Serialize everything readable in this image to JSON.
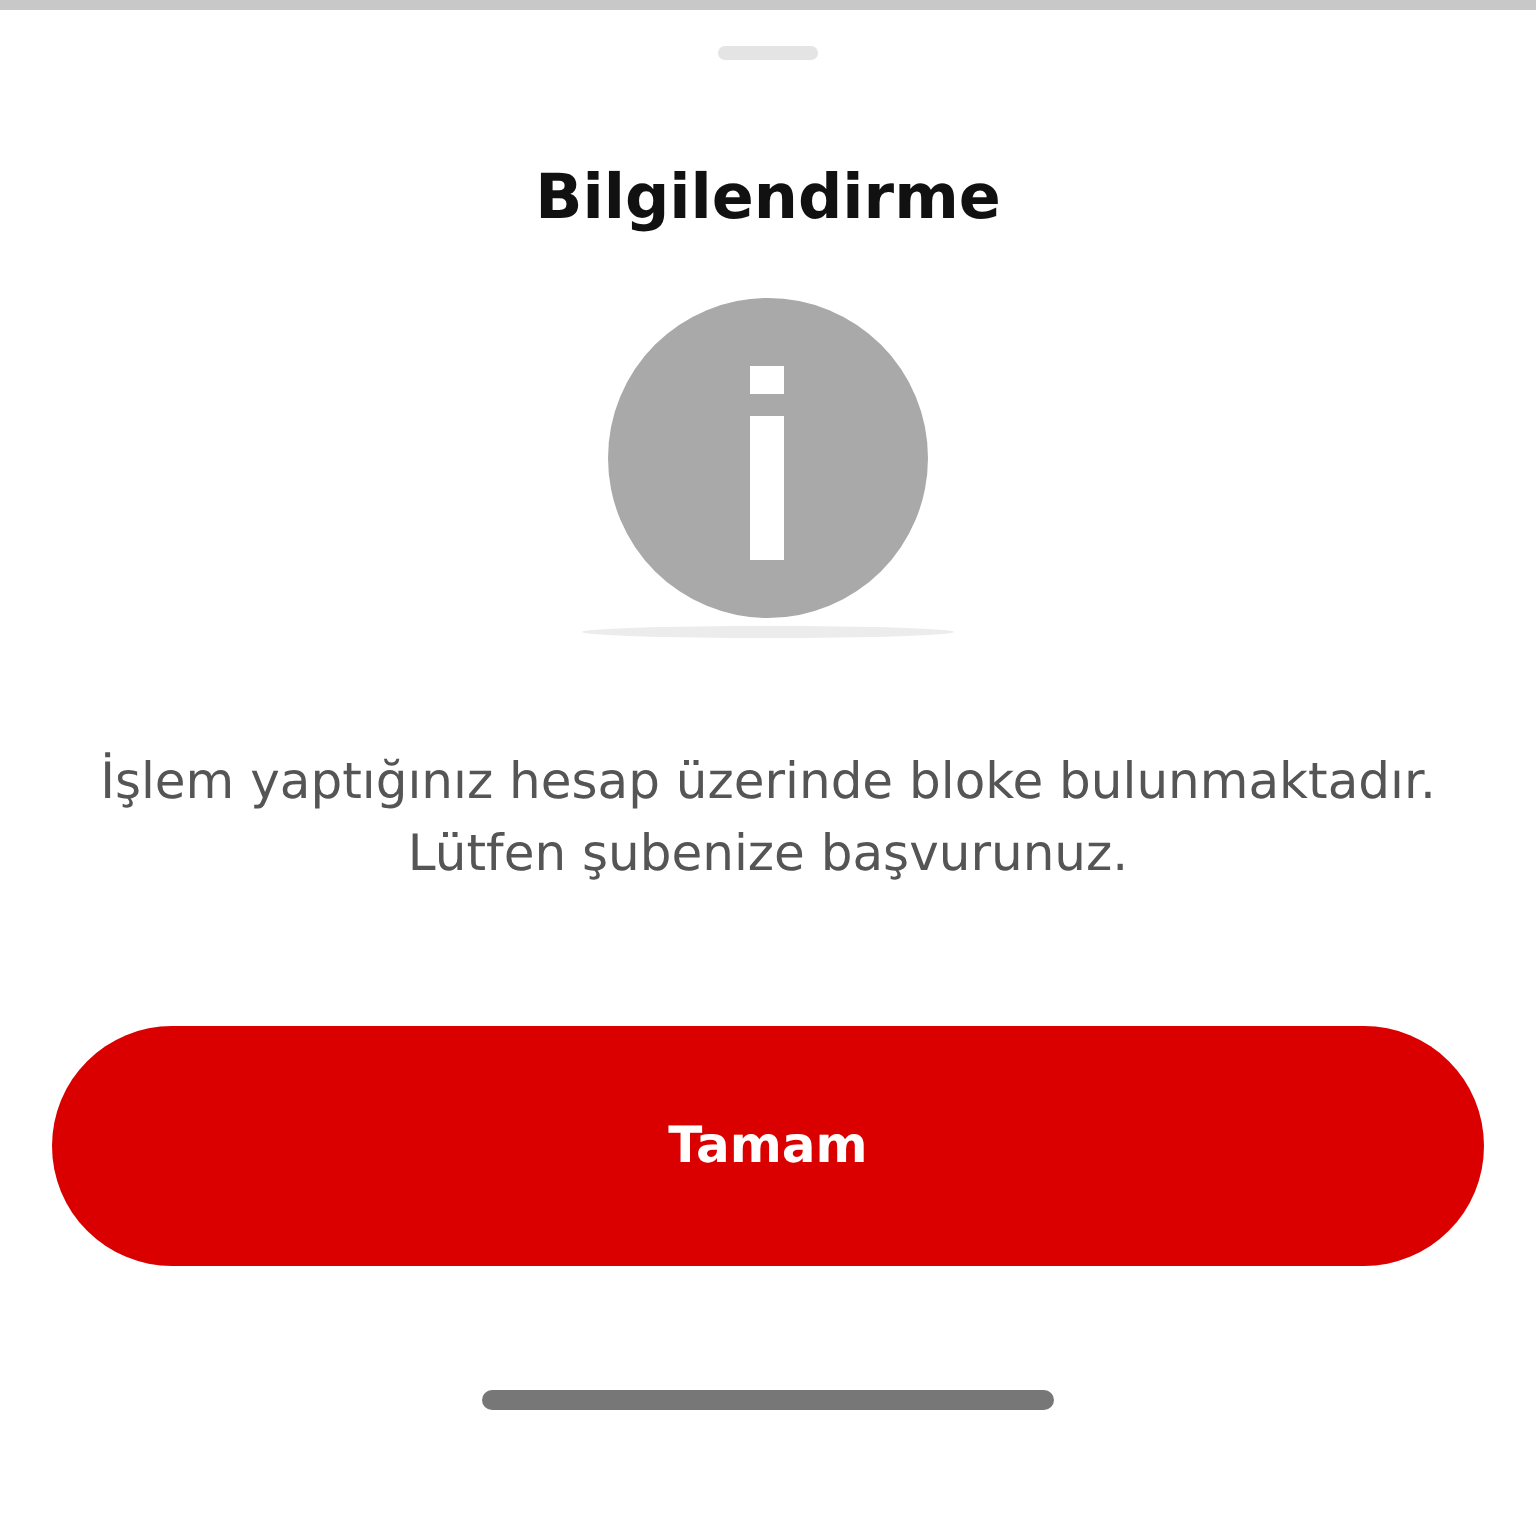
{
  "title": "Bilgilendirme",
  "message": "İşlem yaptığınız hesap üzerinde bloke bulunmaktadır. Lütfen şubenize başvurunuz.",
  "buttons": [
    {
      "label": "Tamam",
      "kind": "primary"
    }
  ]
}
